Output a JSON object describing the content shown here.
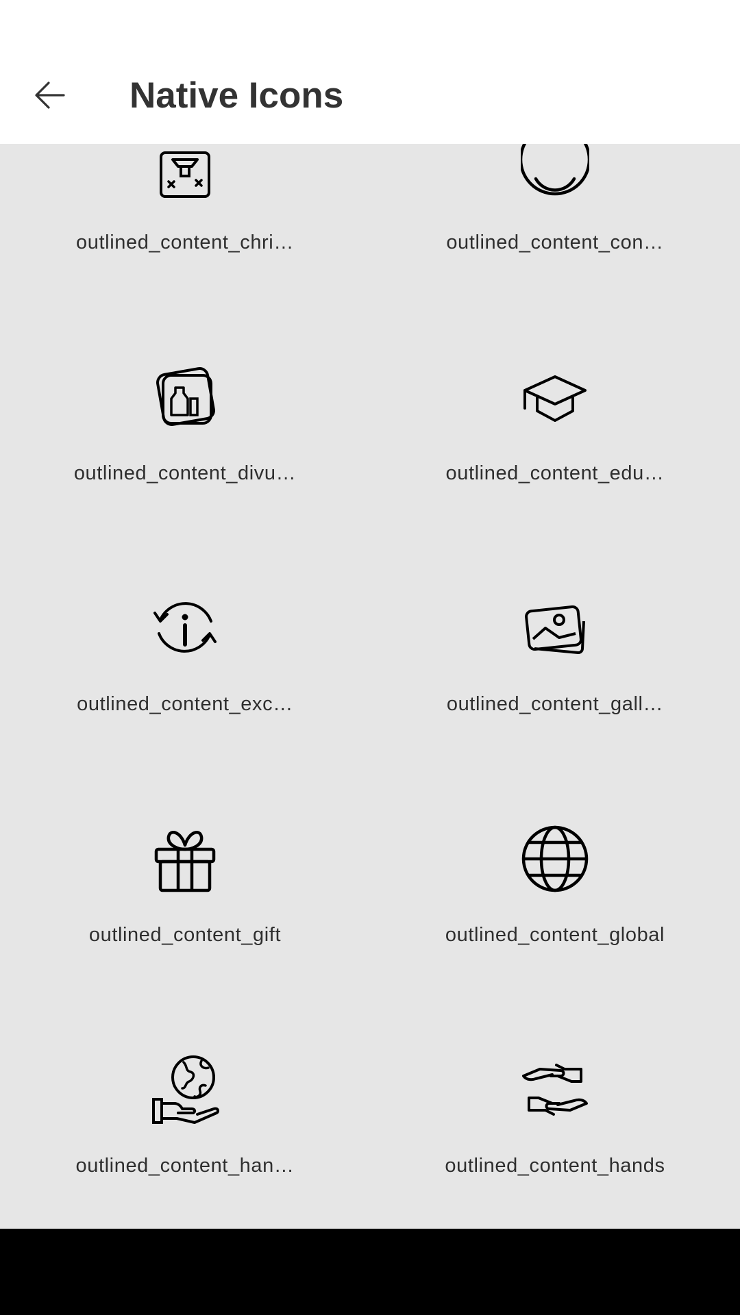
{
  "header": {
    "title": "Native Icons",
    "back_icon": "arrow-left-icon"
  },
  "icons": [
    {
      "label": "outlined_content_chri…",
      "icon": "christmas-icon"
    },
    {
      "label": "outlined_content_con…",
      "icon": "content-circle-icon"
    },
    {
      "label": "outlined_content_divu…",
      "icon": "divulgation-icon"
    },
    {
      "label": "outlined_content_edu…",
      "icon": "graduation-cap-icon"
    },
    {
      "label": "outlined_content_exc…",
      "icon": "exchange-info-icon"
    },
    {
      "label": "outlined_content_gall…",
      "icon": "gallery-icon"
    },
    {
      "label": "outlined_content_gift",
      "icon": "gift-icon"
    },
    {
      "label": "outlined_content_global",
      "icon": "globe-icon"
    },
    {
      "label": "outlined_content_han…",
      "icon": "hand-globe-icon"
    },
    {
      "label": "outlined_content_hands",
      "icon": "hands-icon"
    }
  ],
  "colors": {
    "background": "#e6e6e6",
    "app_bar": "#ffffff",
    "text": "#2e2e2e",
    "nav_bar": "#000000"
  }
}
